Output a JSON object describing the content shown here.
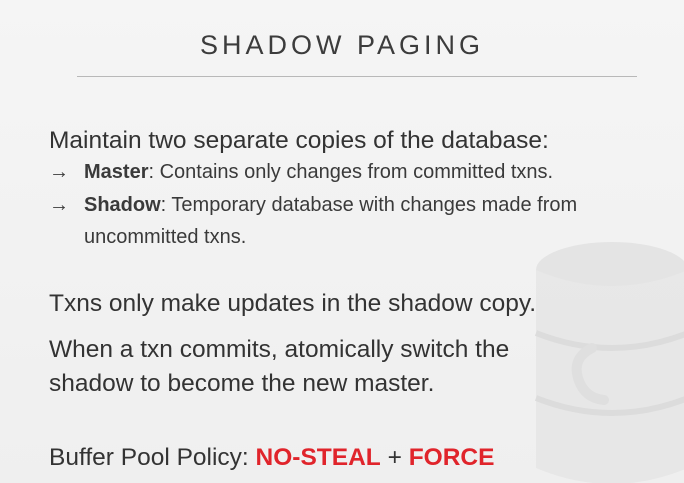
{
  "slide": {
    "title": "SHADOW PAGING",
    "intro": "Maintain two separate copies of the database:",
    "bullets": [
      {
        "arrow": "→",
        "term": "Master",
        "text": ": Contains only changes from committed txns."
      },
      {
        "arrow": "→",
        "term": "Shadow",
        "text": ": Temporary database with changes made from",
        "continuation": "uncommitted txns."
      }
    ],
    "statement1": "Txns only make updates in the shadow copy.",
    "statement2_line1": "When a txn commits, atomically switch the",
    "statement2_line2": "shadow to become the new master.",
    "policy": {
      "label": "Buffer Pool Policy: ",
      "value1": "NO-STEAL",
      "plus": " + ",
      "value2": "FORCE"
    }
  },
  "colors": {
    "background": "#f2f2f2",
    "text": "#333333",
    "accent": "#e0242b",
    "watermark": "#dcdcdc"
  },
  "icons": {
    "watermark": "database-icon"
  }
}
